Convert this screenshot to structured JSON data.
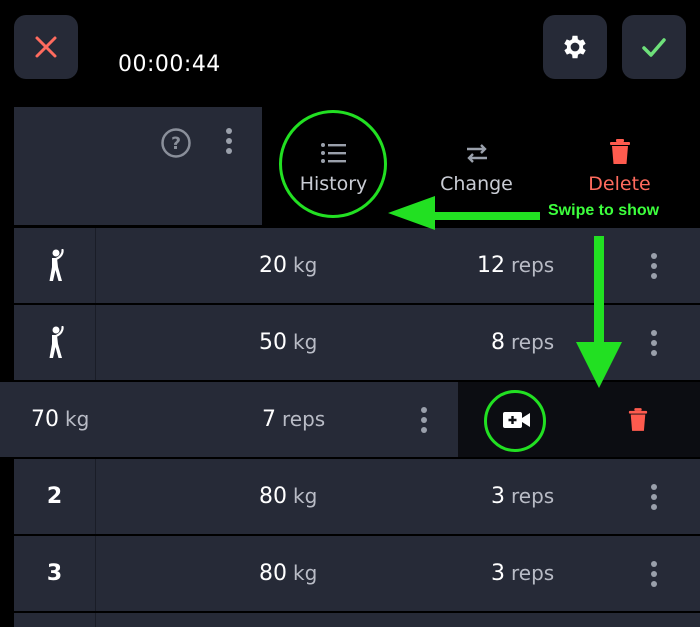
{
  "header": {
    "timer": "00:00:44",
    "close_icon": "close-icon",
    "settings_icon": "gear-icon",
    "confirm_icon": "check-icon"
  },
  "exercise_header": {
    "help_icon": "help-icon",
    "menu_icon": "more-vertical-icon"
  },
  "swipe_actions": {
    "history": {
      "label": "History",
      "icon": "list-icon"
    },
    "change": {
      "label": "Change",
      "icon": "swap-icon"
    },
    "delete": {
      "label": "Delete",
      "icon": "trash-icon"
    }
  },
  "annotation": {
    "text": "Swipe to show"
  },
  "sets": [
    {
      "marker": "warmup-icon",
      "weight": "20",
      "weight_unit": "kg",
      "reps": "12",
      "reps_unit": "reps"
    },
    {
      "marker": "warmup-icon",
      "weight": "50",
      "weight_unit": "kg",
      "reps": "8",
      "reps_unit": "reps"
    },
    {
      "weight": "70",
      "weight_unit": "kg",
      "reps": "7",
      "reps_unit": "reps",
      "swiped": true,
      "actions": [
        "video-add-icon",
        "trash-icon"
      ]
    },
    {
      "set_number": "2",
      "weight": "80",
      "weight_unit": "kg",
      "reps": "3",
      "reps_unit": "reps"
    },
    {
      "set_number": "3",
      "weight": "80",
      "weight_unit": "kg",
      "reps": "3",
      "reps_unit": "reps"
    }
  ],
  "colors": {
    "panel": "#262a37",
    "delete": "#ff6b5e",
    "highlight": "#22e022",
    "accent_check": "#6ee07a"
  }
}
